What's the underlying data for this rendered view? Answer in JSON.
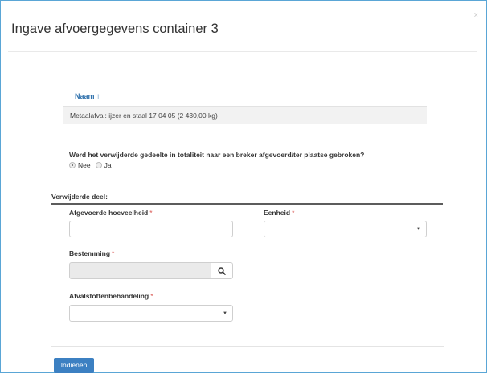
{
  "dialog": {
    "title": "Ingave afvoergegevens container 3",
    "close_label": "x"
  },
  "table": {
    "column_header": "Naam",
    "sort_arrow": "↑",
    "rows": [
      "Metaalafval: ijzer en staal 17 04 05 (2 430,00 kg)"
    ]
  },
  "question": {
    "text": "Werd het verwijderde gedeelte in totaliteit naar een breker afgevoerd/ter plaatse gebroken?",
    "options": [
      {
        "label": "Nee",
        "selected": true
      },
      {
        "label": "Ja",
        "selected": false
      }
    ]
  },
  "section": {
    "label": "Verwijderde deel:"
  },
  "fields": {
    "quantity_label": "Afgevoerde hoeveelheid",
    "unit_label": "Eenheid",
    "destination_label": "Bestemming",
    "treatment_label": "Afvalstoffenbehandeling",
    "required_mark": "*"
  },
  "icons": {
    "search": "search-icon",
    "dropdown": "chevron-down-icon"
  },
  "submit": {
    "label": "Indienen"
  },
  "colors": {
    "accent": "#3c80c2",
    "link": "#3072ad",
    "required": "#d9534f",
    "frame": "#5aa6d6"
  }
}
